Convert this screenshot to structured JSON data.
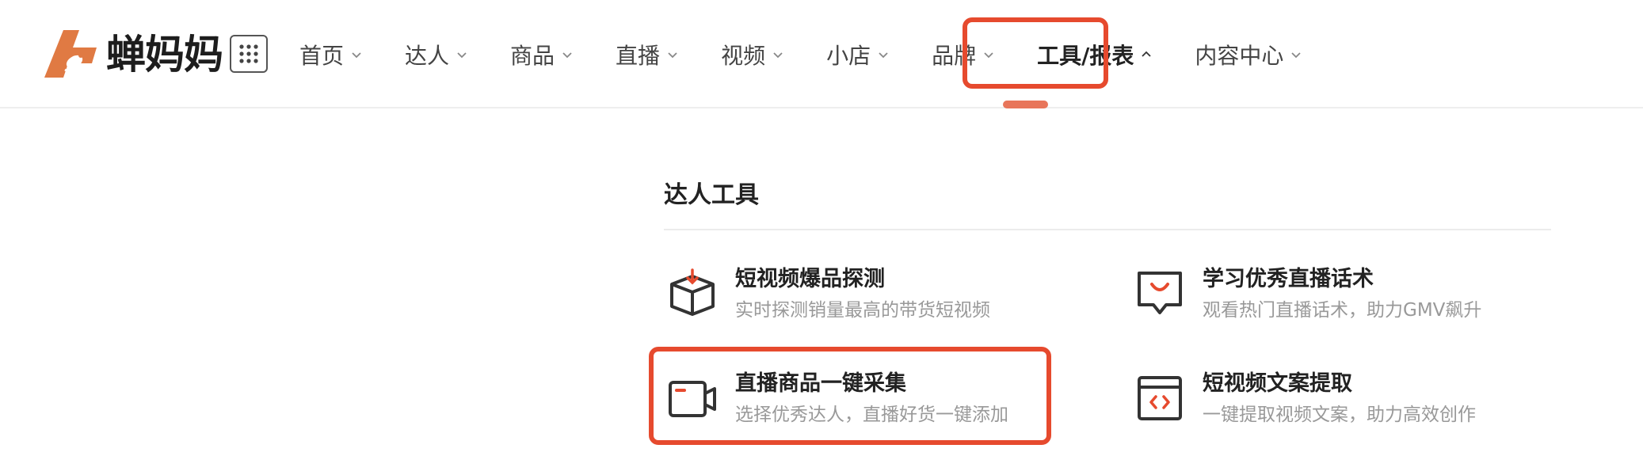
{
  "brand": {
    "name": "蝉妈妈",
    "accent": "#e64a2e",
    "logo_color": "#e07a43"
  },
  "nav": {
    "items": [
      {
        "label": "首页",
        "active": false
      },
      {
        "label": "达人",
        "active": false
      },
      {
        "label": "商品",
        "active": false
      },
      {
        "label": "直播",
        "active": false
      },
      {
        "label": "视频",
        "active": false
      },
      {
        "label": "小店",
        "active": false
      },
      {
        "label": "品牌",
        "active": false
      },
      {
        "label": "工具/报表",
        "active": true
      },
      {
        "label": "内容中心",
        "active": false
      }
    ]
  },
  "dropdown": {
    "section_title": "达人工具",
    "tools": [
      {
        "title": "短视频爆品探测",
        "subtitle": "实时探测销量最高的带货短视频",
        "icon": "box-download-icon"
      },
      {
        "title": "学习优秀直播话术",
        "subtitle": "观看热门直播话术，助力GMV飙升",
        "icon": "chat-bubble-smile-icon"
      },
      {
        "title": "直播商品一键采集",
        "subtitle": "选择优秀达人，直播好货一键添加",
        "icon": "video-camera-icon"
      },
      {
        "title": "短视频文案提取",
        "subtitle": "一键提取视频文案，助力高效创作",
        "icon": "code-window-icon"
      }
    ]
  }
}
